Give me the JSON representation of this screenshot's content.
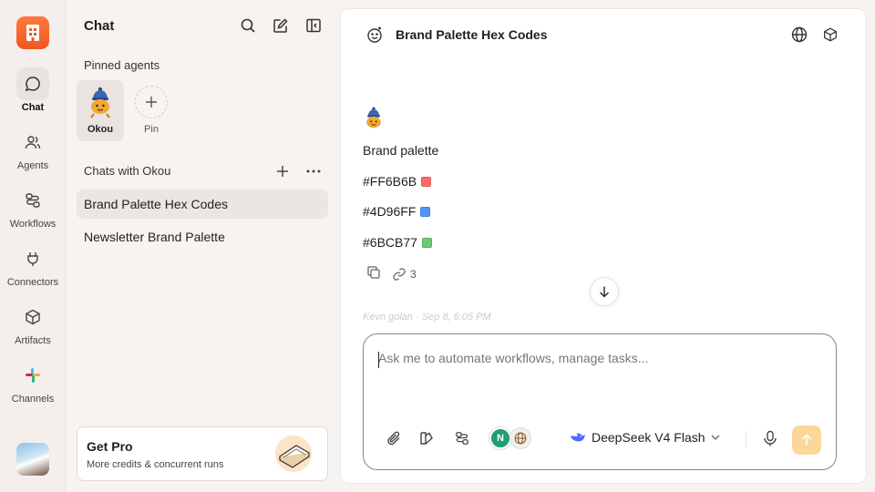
{
  "rail": {
    "items": [
      {
        "label": "Chat",
        "icon": "chat-bubble-icon"
      },
      {
        "label": "Agents",
        "icon": "users-icon"
      },
      {
        "label": "Workflows",
        "icon": "workflow-icon"
      },
      {
        "label": "Connectors",
        "icon": "plug-icon"
      },
      {
        "label": "Artifacts",
        "icon": "cube-icon"
      },
      {
        "label": "Channels",
        "icon": "slack-icon"
      }
    ]
  },
  "sidebar": {
    "title": "Chat",
    "pinned_label": "Pinned agents",
    "pinned_agent": "Okou",
    "pin_label": "Pin",
    "chats_label": "Chats with Okou",
    "chats": [
      "Brand Palette Hex Codes",
      "Newsletter Brand Palette"
    ],
    "get_pro": {
      "title": "Get Pro",
      "subtitle": "More credits & concurrent runs"
    }
  },
  "main": {
    "title": "Brand Palette Hex Codes",
    "message": {
      "heading": "Brand palette",
      "colors": [
        {
          "hex": "#FF6B6B",
          "swatch": "#FF6B6B"
        },
        {
          "hex": "#4D96FF",
          "swatch": "#4D96FF"
        },
        {
          "hex": "#6BCB77",
          "swatch": "#6BCB77"
        }
      ],
      "source_count": "3"
    },
    "faded_meta": "Kevn golan · Sep 8, 6:05 PM",
    "composer": {
      "placeholder": "Ask me to automate workflows, manage tasks...",
      "model": "DeepSeek V4 Flash",
      "badge_letter": "N"
    }
  },
  "colors": {
    "accent": "#F2551F",
    "send": "#FDD69A"
  }
}
